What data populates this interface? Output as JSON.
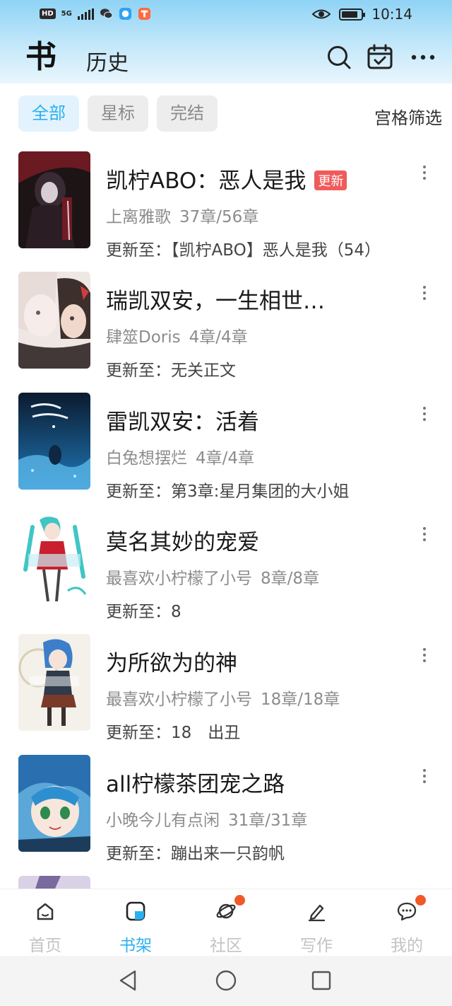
{
  "status_bar": {
    "network_label": "HD",
    "signal_label": "5G",
    "time": "10:14",
    "battery_percent": 85
  },
  "header": {
    "logo": "书",
    "title": "历史",
    "icons": [
      "search-icon",
      "calendar-check-icon",
      "more-horizontal-icon"
    ]
  },
  "filters": {
    "tabs": [
      {
        "label": "全部",
        "active": true
      },
      {
        "label": "星标",
        "active": false
      },
      {
        "label": "完结",
        "active": false
      }
    ],
    "grid_filter_label": "宫格筛选"
  },
  "books": [
    {
      "title": "凯柠ABO：恶人是我",
      "badge": "更新",
      "author": "上离雅歌",
      "progress": "37章/56章",
      "update": "更新至：【凯柠ABO】恶人是我（54）"
    },
    {
      "title": "瑞凯双安，一生相世…",
      "author": "肆筮Doris",
      "progress": "4章/4章",
      "update": "更新至：无关正文"
    },
    {
      "title": "雷凯双安：活着",
      "author": "白兔想摆烂",
      "progress": "4章/4章",
      "update": "更新至：第3章:星月集团的大小姐"
    },
    {
      "title": "莫名其妙的宠爱",
      "author": "最喜欢小柠檬了小号",
      "progress": "8章/8章",
      "update": "更新至：8"
    },
    {
      "title": "为所欲为的神",
      "author": "最喜欢小柠檬了小号",
      "progress": "18章/18章",
      "update": "更新至：18　出丑"
    },
    {
      "title": "all柠檬茶团宠之路",
      "author": "小晚今儿有点闲",
      "progress": "31章/31章",
      "update": "更新至：蹦出来一只韵帆"
    }
  ],
  "bottom_nav": [
    {
      "label": "首页",
      "icon": "home-icon",
      "active": false,
      "dot": false
    },
    {
      "label": "书架",
      "icon": "bookshelf-icon",
      "active": true,
      "dot": false
    },
    {
      "label": "社区",
      "icon": "planet-icon",
      "active": false,
      "dot": true
    },
    {
      "label": "写作",
      "icon": "pen-icon",
      "active": false,
      "dot": false
    },
    {
      "label": "我的",
      "icon": "chat-bubble-icon",
      "active": false,
      "dot": true
    }
  ],
  "system_nav": [
    "back-icon",
    "home-circle-icon",
    "recents-icon"
  ],
  "colors": {
    "accent": "#2bb0f0",
    "badge": "#f05a5a",
    "notification_dot": "#f05a2a",
    "inactive_nav": "#c3c3c3"
  }
}
